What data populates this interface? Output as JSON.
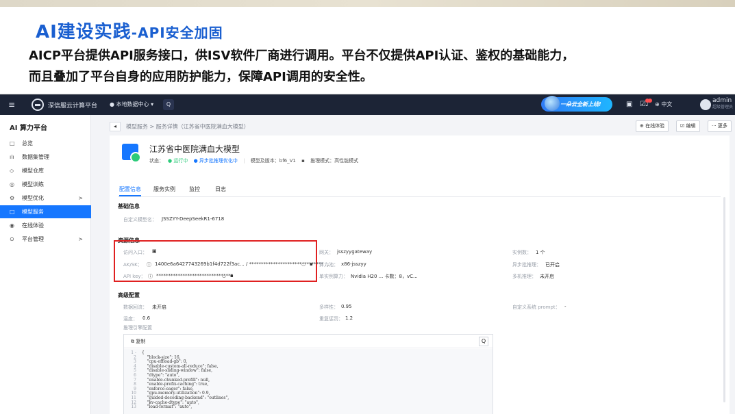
{
  "slide": {
    "title": "AI建设实践",
    "subtitle": "-API安全加固",
    "line1": "AICP平台提供API服务接口，供ISV软件厂商进行调用。平台不仅提供API认证、鉴权的基础能力，",
    "line2": "而且叠加了平台自身的应用防护能力，保障API调用的安全性。"
  },
  "topbar": {
    "brand": "深信服云计算平台",
    "region": "● 本地数据中心 ▾",
    "promo": "一朵云全新上线!",
    "lang": "⊕ 中文",
    "user": "admin",
    "user_role": "超级管理员"
  },
  "sidebar": {
    "title": "AI 算力平台",
    "items": [
      {
        "icon": "□",
        "label": "总览"
      },
      {
        "icon": "ılı",
        "label": "数据集管理"
      },
      {
        "icon": "◇",
        "label": "模型仓库"
      },
      {
        "icon": "◎",
        "label": "模型训练"
      },
      {
        "icon": "⚙",
        "label": "模型优化",
        "chevron": ">"
      },
      {
        "icon": "□",
        "label": "模型服务"
      },
      {
        "icon": "◉",
        "label": "在线体验"
      },
      {
        "icon": "⊙",
        "label": "平台管理",
        "chevron": ">"
      }
    ]
  },
  "breadcrumb": {
    "back": "◂",
    "text": "模型服务  >  服务详情（江苏省中医院满血大模型）"
  },
  "actions": {
    "online": "在线体验",
    "edit": "编辑",
    "more": "··· 更多"
  },
  "model": {
    "name": "江苏省中医院满血大模型",
    "status_label": "状态：",
    "status": "● 运行中",
    "state2": "● 异步批推理优化中",
    "version": "模型及版本：bf6_V1",
    "mode": "推理模式：高性能模式"
  },
  "tabs": [
    "配置信息",
    "服务实例",
    "监控",
    "日志"
  ],
  "basic": {
    "title": "基础信息",
    "name_label": "自定义模型名：",
    "name_value": "JSSZYY-DeepSeekR1-6718"
  },
  "resource": {
    "title": "资源信息",
    "entry_label": "访问入口：",
    "aksk_label": "AK/SK：",
    "aksk_value": "1400e6a6427743269b1f4d722f3ac... / ******************************* ...",
    "apikey_label": "API key：",
    "apikey_value": "********************************",
    "gateway_label": "网关：",
    "gateway_value": "jsszyygateway",
    "arch_label": "算力池：",
    "arch_value": "x86-jsszyy",
    "spec_label": "单实例算力：",
    "spec_value": "Nvidia H20 ... 卡数：8，vC...",
    "inst_label": "实例数：",
    "inst_value": "1 个",
    "async_label": "异步批推理：",
    "async_value": "已开启",
    "multi_label": "多机推理：",
    "multi_value": "未开启"
  },
  "advanced": {
    "title": "高级配置",
    "retain_label": "数据回流：",
    "retain_value": "未开启",
    "temp_label": "温度：",
    "temp_value": "0.6",
    "engine_label": "推理引擎配置",
    "diversity_label": "多样性：",
    "diversity_value": "0.95",
    "penalty_label": "重复惩罚：",
    "penalty_value": "1.2",
    "prompt_label": "自定义系统 prompt：",
    "prompt_value": "-"
  },
  "code": {
    "copy": "复制",
    "lines": [
      "{",
      "    \"block-size\": 16,",
      "    \"cpu-offload-gb\": 0,",
      "    \"disable-custom-all-reduce\": false,",
      "    \"disable-sliding-window\": false,",
      "    \"dtype\": \"auto\",",
      "    \"enable-chunked-prefill\": null,",
      "    \"enable-prefix-caching\": true,",
      "    \"enforce-eager\": false,",
      "    \"gpu-memory-utilization\": 0.9,",
      "    \"guided-decoding-backend\": \"outlines\",",
      "    \"kv-cache-dtype\": \"auto\",",
      "    \"load-format\": \"auto\","
    ],
    "gutter": [
      "1 -",
      "2",
      "3",
      "4",
      "5",
      "6",
      "7",
      "8",
      "9",
      "10",
      "11",
      "12",
      "13"
    ]
  },
  "colors": {
    "accent": "#1677ff",
    "highlight": "#e02020",
    "running": "#2ccb7a"
  }
}
